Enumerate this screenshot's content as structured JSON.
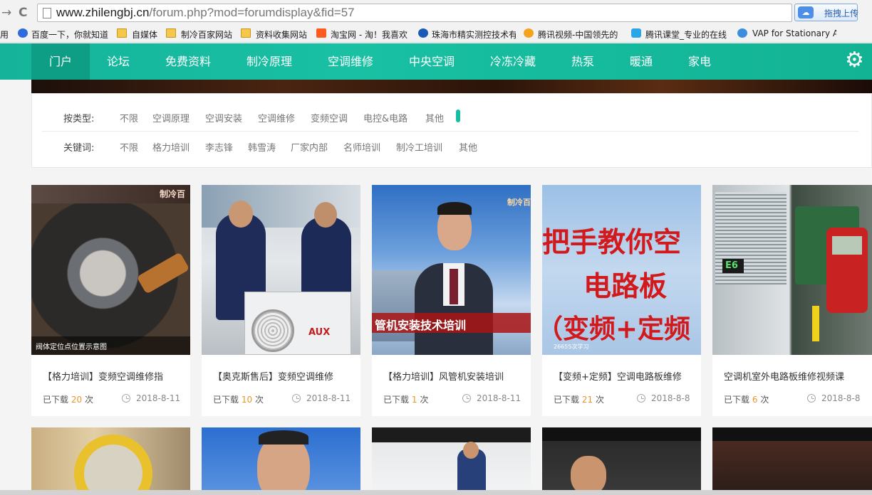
{
  "browser": {
    "url_host": "www.zhilengbj.cn",
    "url_path": "/forum.php?mod=forumdisplay&fid=57",
    "upload_label": "拖拽上传",
    "bookmarks": [
      {
        "label": "用"
      },
      {
        "label": "百度一下，你就知道"
      },
      {
        "label": "自媒体"
      },
      {
        "label": "制冷百家网站"
      },
      {
        "label": "资料收集网站"
      },
      {
        "label": "淘宝网 - 淘！我喜欢"
      },
      {
        "label": "珠海市精实测控技术有"
      },
      {
        "label": "腾讯视频-中国领先的"
      },
      {
        "label": "腾讯课堂_专业的在线"
      },
      {
        "label": "VAP for Stationary A"
      }
    ]
  },
  "nav": {
    "items": [
      "门户",
      "论坛",
      "免费资料",
      "制冷原理",
      "空调维修",
      "中央空调",
      "冷冻冷藏",
      "热泵",
      "暖通",
      "家电"
    ]
  },
  "filter": {
    "type_label": "按类型:",
    "type_options": [
      "不限",
      "空调原理",
      "空调安装",
      "空调维修",
      "变频空调",
      "电控&电路",
      "其他"
    ],
    "keyword_label": "关键词:",
    "keyword_options": [
      "不限",
      "格力培训",
      "李志锋",
      "韩雪涛",
      "厂家内部",
      "名师培训",
      "制冷工培训",
      "其他"
    ]
  },
  "cards": [
    {
      "title": "【格力培训】变频空调维修指",
      "downloaded": "已下载",
      "count": "20",
      "unit": "次",
      "date": "2018-8-11",
      "thumb_text": "制冷百",
      "thumb_caption": "阀体定位点位置示意图"
    },
    {
      "title": "【奥克斯售后】变频空调维修",
      "downloaded": "已下载",
      "count": "10",
      "unit": "次",
      "date": "2018-8-11",
      "thumb_text": "AUX"
    },
    {
      "title": "【格力培训】风管机安装培训",
      "downloaded": "已下载",
      "count": "1",
      "unit": "次",
      "date": "2018-8-11",
      "thumb_text": "制冷百",
      "thumb_caption": "管机安装技术培训"
    },
    {
      "title": "【变频+定频】空调电路板维修",
      "downloaded": "已下载",
      "count": "21",
      "unit": "次",
      "date": "2018-8-8",
      "thumb_line1": "把手教你空",
      "thumb_line2": "电路板",
      "thumb_line3": "（变频+定频",
      "thumb_small": "26655次学习"
    },
    {
      "title": "空调机室外电路板维修视频课",
      "downloaded": "已下载",
      "count": "6",
      "unit": "次",
      "date": "2018-8-8",
      "thumb_text": "E6"
    }
  ]
}
